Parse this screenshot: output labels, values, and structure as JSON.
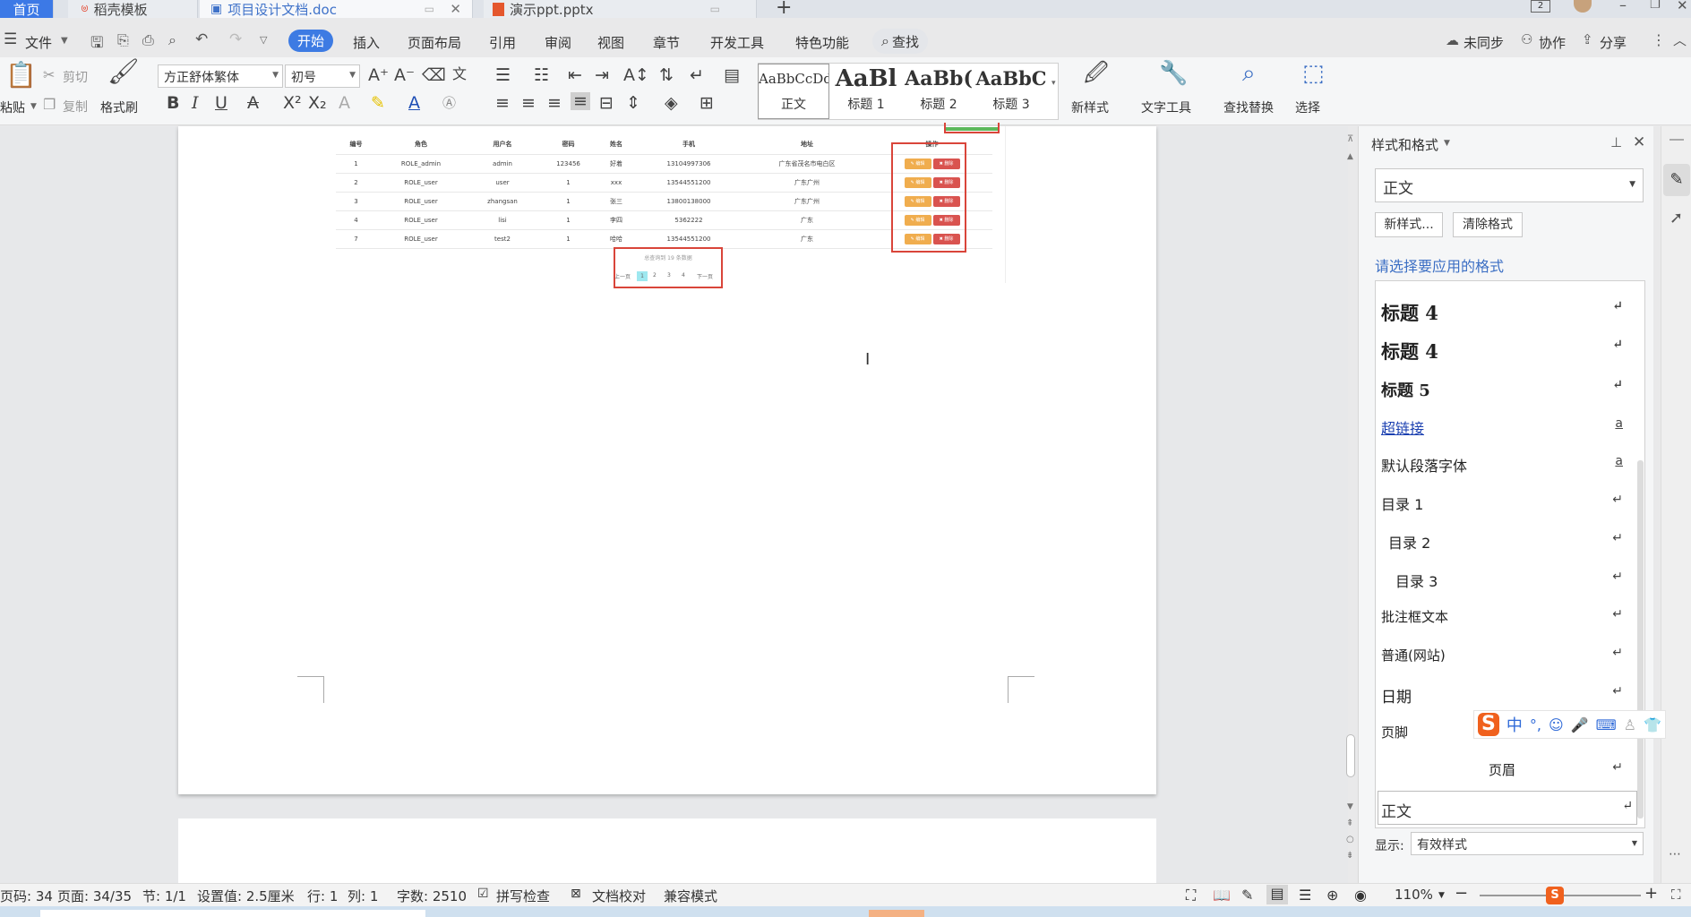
{
  "tabs": {
    "home": "首页",
    "template": "稻壳模板",
    "doc": "项目设计文档.doc",
    "ppt": "演示ppt.pptx",
    "new_tab": "+",
    "badge": "2"
  },
  "menubar": {
    "file": "文件",
    "items": [
      "开始",
      "插入",
      "页面布局",
      "引用",
      "审阅",
      "视图",
      "章节",
      "开发工具",
      "特色功能"
    ],
    "search": "查找",
    "right": [
      "未同步",
      "协作",
      "分享"
    ]
  },
  "ribbon": {
    "paste": "粘贴",
    "cut": "剪切",
    "copy": "复制",
    "format_painter": "格式刷",
    "font_name": "方正舒体繁体",
    "font_size": "初号",
    "styles": [
      {
        "preview": "AaBbCcDd",
        "name": "正文"
      },
      {
        "preview": "AaBl",
        "name": "标题 1"
      },
      {
        "preview": "AaBb(",
        "name": "标题 2"
      },
      {
        "preview": "AaBbC",
        "name": "标题 3"
      }
    ],
    "new_style": "新样式",
    "text_tool": "文字工具",
    "find_replace": "查找替换",
    "select": "选择"
  },
  "document": {
    "table_headers": [
      "编号",
      "角色",
      "用户名",
      "密码",
      "姓名",
      "手机",
      "地址",
      "操作"
    ],
    "table_rows": [
      [
        "1",
        "ROLE_admin",
        "admin",
        "123456",
        "好着",
        "13104997306",
        "广东省茂名市电白区"
      ],
      [
        "2",
        "ROLE_user",
        "user",
        "1",
        "xxx",
        "13544551200",
        "广东广州"
      ],
      [
        "3",
        "ROLE_user",
        "zhangsan",
        "1",
        "张三",
        "13800138000",
        "广东广州"
      ],
      [
        "4",
        "ROLE_user",
        "lisi",
        "1",
        "李四",
        "5362222",
        "广东"
      ],
      [
        "7",
        "ROLE_user",
        "test2",
        "1",
        "哈哈",
        "13544551200",
        "广东"
      ]
    ],
    "edit_label": "✎ 编辑",
    "delete_label": "✖ 删除",
    "pagination_summary": "总查询到 19 条数据",
    "pagination_prev": "上一页",
    "pagination_pages": [
      "1",
      "2",
      "3",
      "4"
    ],
    "pagination_next": "下一页"
  },
  "panel": {
    "title": "样式和格式",
    "current_style": "正文",
    "new_style_btn": "新样式...",
    "clear_format_btn": "清除格式",
    "prompt": "请选择要应用的格式",
    "items": [
      "标题 4",
      "标题 4",
      "标题 5",
      "超链接",
      "默认段落字体",
      "目录 1",
      "目录 2",
      "目录 3",
      "批注框文本",
      "普通(网站)",
      "日期",
      "页脚",
      "页眉",
      "正文"
    ],
    "show_label": "显示:",
    "show_value": "有效样式"
  },
  "ime": {
    "lang": "中"
  },
  "status": {
    "page_no": "页码: 34",
    "pages": "页面: 34/35",
    "section": "节: 1/1",
    "setting": "设置值: 2.5厘米",
    "row": "行: 1",
    "col": "列: 1",
    "words": "字数: 2510",
    "spell": "拼写检查",
    "proof": "文档校对",
    "compat": "兼容模式",
    "zoom": "110%"
  },
  "colors": {
    "accent": "#3d7be3",
    "red_box": "#d9453a",
    "edit_btn": "#f0ad4e",
    "delete_btn": "#d9534f"
  }
}
